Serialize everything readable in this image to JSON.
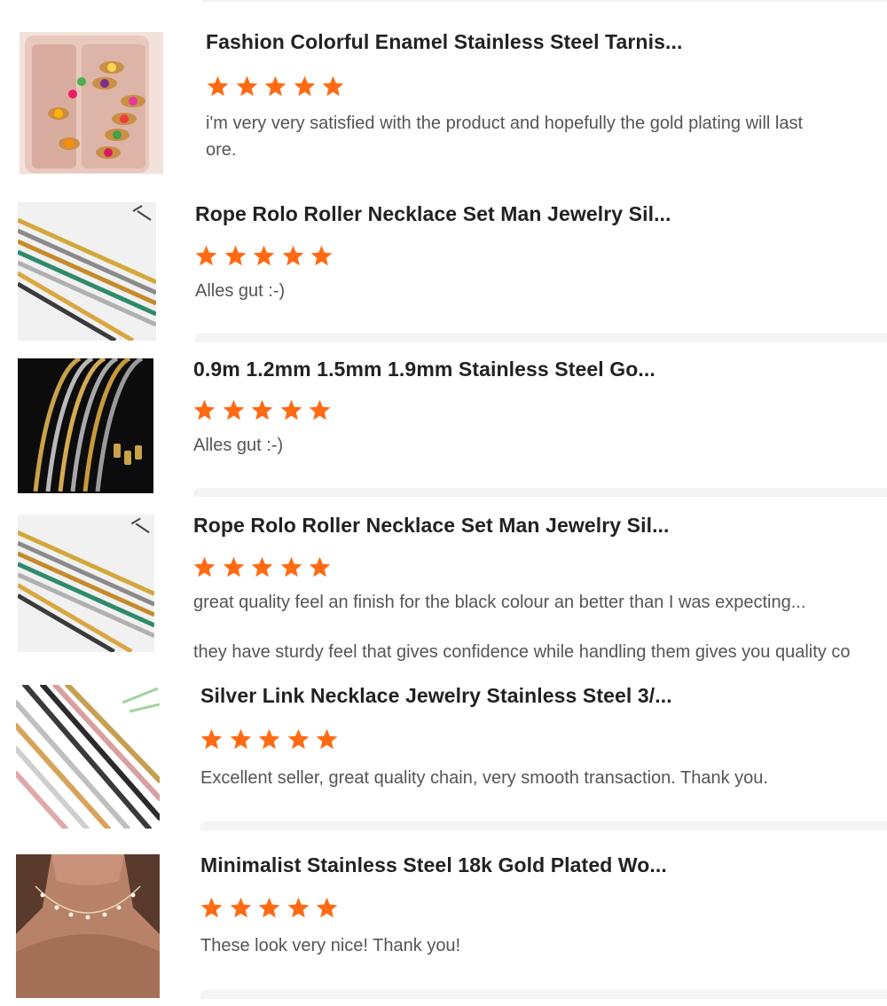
{
  "reviews": [
    {
      "title": "Fashion Colorful Enamel Stainless Steel Tarnis...",
      "rating": 5,
      "image": "enamel-rings-in-pink-box",
      "text_lines": [
        "i'm very very satisfied with the product and hopefully the gold plating will last",
        "ore."
      ]
    },
    {
      "title": "Rope Rolo Roller Necklace Set Man Jewelry Sil...",
      "rating": 5,
      "image": "multicolor-chain-set",
      "text_lines": [
        "Alles gut :-)"
      ]
    },
    {
      "title": "0.9m 1.2mm 1.5mm 1.9mm Stainless Steel Go...",
      "rating": 5,
      "image": "chains-on-black",
      "text_lines": [
        "Alles gut :-)"
      ]
    },
    {
      "title": "Rope Rolo Roller Necklace Set Man Jewelry Sil...",
      "rating": 5,
      "image": "multicolor-chain-set",
      "text_lines": [
        "great quality feel an finish for the black colour an better than I was expecting...",
        "they have sturdy feel that gives confidence while handling them gives you quality co"
      ]
    },
    {
      "title": "Silver Link Necklace Jewelry Stainless Steel 3/...",
      "rating": 5,
      "image": "diagonal-link-chains",
      "text_lines": [
        "Excellent seller, great quality chain, very smooth transaction. Thank you."
      ]
    },
    {
      "title": "Minimalist Stainless Steel 18k Gold Plated Wo...",
      "rating": 5,
      "image": "pearl-choker-on-neck",
      "text_lines": [
        "These look very nice! Thank you!"
      ]
    }
  ],
  "colors": {
    "star": "#ff6a13",
    "title": "#222222",
    "body_text": "#555555",
    "separator": "#f4f4f4"
  },
  "icons": {
    "rating": "star-icon"
  }
}
